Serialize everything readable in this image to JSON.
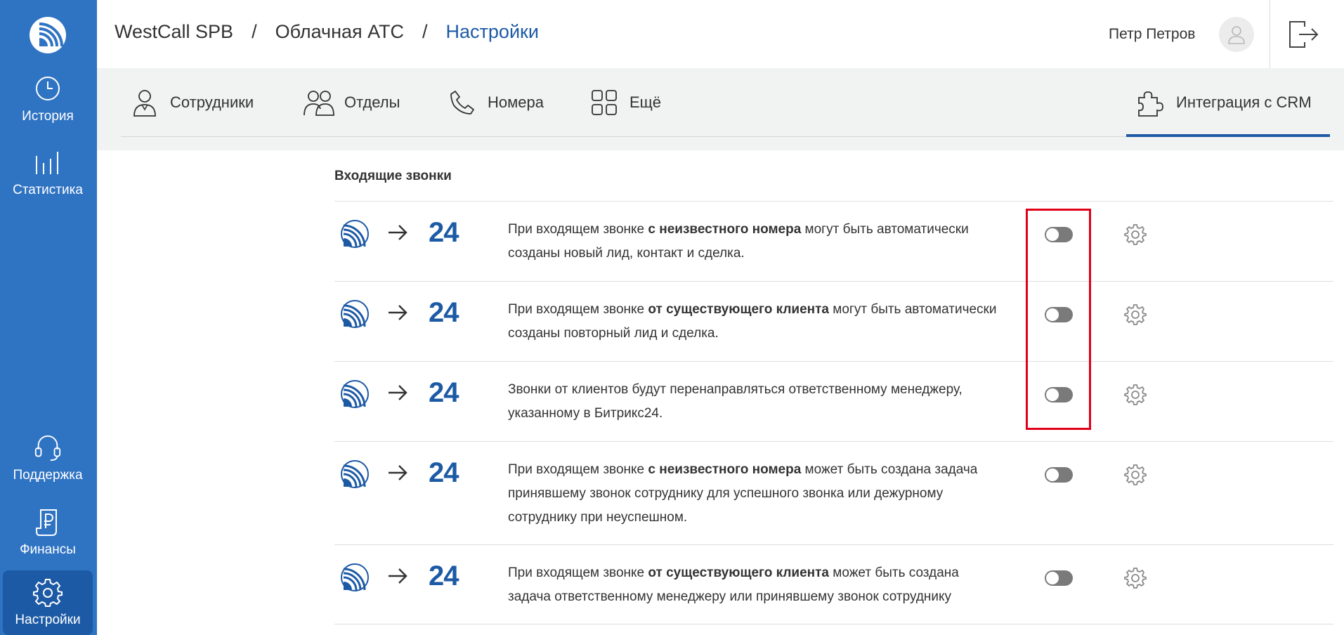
{
  "sidebar": {
    "logo": "westcall-logo",
    "items": [
      {
        "label": "История",
        "icon": "clock-icon"
      },
      {
        "label": "Статистика",
        "icon": "bar-chart-icon"
      },
      {
        "label": "Поддержка",
        "icon": "headset-icon"
      },
      {
        "label": "Финансы",
        "icon": "ruble-receipt-icon"
      },
      {
        "label": "Настройки",
        "icon": "gear-icon",
        "active": true
      }
    ]
  },
  "header": {
    "breadcrumb": [
      "WestCall SPB",
      "Облачная АТС",
      "Настройки"
    ],
    "separator": "/",
    "user_name": "Петр Петров"
  },
  "tabs": [
    {
      "label": "Сотрудники",
      "icon": "person-icon"
    },
    {
      "label": "Отделы",
      "icon": "group-icon"
    },
    {
      "label": "Номера",
      "icon": "phone-icon"
    },
    {
      "label": "Ещё",
      "icon": "grid-icon"
    },
    {
      "label": "Интеграция с CRM",
      "icon": "puzzle-icon",
      "active": true
    }
  ],
  "section_title": "Входящие звонки",
  "b24_label": "24",
  "rules": [
    {
      "pre": "При входящем звонке ",
      "bold": "с неизвестного номера",
      "post": " могут быть автоматически созданы новый лид, контакт и сделка.",
      "enabled": false
    },
    {
      "pre": "При входящем звонке ",
      "bold": "от существующего клиента",
      "post": " могут быть автоматически созданы повторный лид и сделка.",
      "enabled": false
    },
    {
      "pre": "Звонки от клиентов будут перенаправляться ответственному менеджеру, указанному в Битрикс24.",
      "bold": "",
      "post": "",
      "enabled": false
    },
    {
      "pre": "При входящем звонке ",
      "bold": "с неизвестного номера",
      "post": " может быть создана задача принявшему звонок сотруднику для успешного звонка или дежурному сотруднику при неуспешном.",
      "enabled": false
    },
    {
      "pre": "При входящем звонке ",
      "bold": "от существующего клиента",
      "post": " может быть создана задача ответственному менеджеру или принявшему звонок сотруднику",
      "enabled": false
    }
  ],
  "colors": {
    "brand": "#2f73c3",
    "accent": "#1d5aa5",
    "highlight": "#e0001a"
  }
}
